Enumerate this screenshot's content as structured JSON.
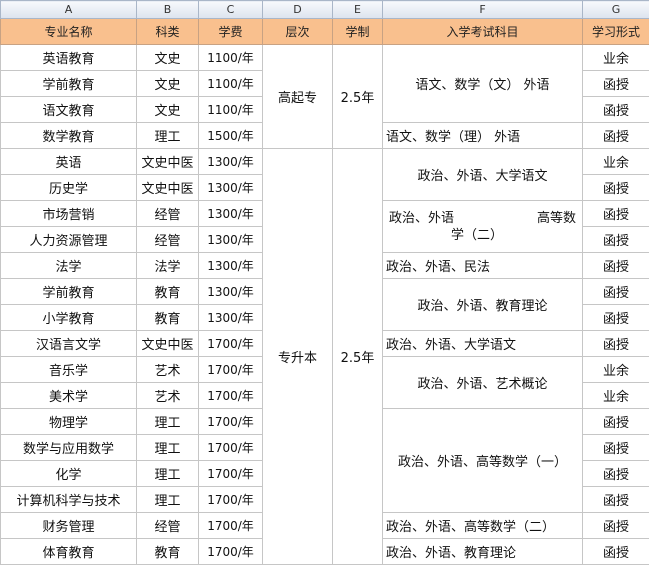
{
  "columns": [
    "A",
    "B",
    "C",
    "D",
    "E",
    "F",
    "G"
  ],
  "headers": [
    "专业名称",
    "科类",
    "学费",
    "层次",
    "学制",
    "入学考试科目",
    "学习形式"
  ],
  "groups": [
    {
      "level": "高起专",
      "duration": "2.5年"
    },
    {
      "level": "专升本",
      "duration": "2.5年"
    }
  ],
  "rows": [
    {
      "major": "英语教育",
      "category": "文史",
      "fee": "1100/年",
      "mode": "业余"
    },
    {
      "major": "学前教育",
      "category": "文史",
      "fee": "1100/年",
      "mode": "函授"
    },
    {
      "major": "语文教育",
      "category": "文史",
      "fee": "1100/年",
      "mode": "函授"
    },
    {
      "major": "数学教育",
      "category": "理工",
      "fee": "1500/年",
      "mode": "函授"
    },
    {
      "major": "英语",
      "category": "文史中医",
      "fee": "1300/年",
      "mode": "业余"
    },
    {
      "major": "历史学",
      "category": "文史中医",
      "fee": "1300/年",
      "mode": "函授"
    },
    {
      "major": "市场营销",
      "category": "经管",
      "fee": "1300/年",
      "mode": "函授"
    },
    {
      "major": "人力资源管理",
      "category": "经管",
      "fee": "1300/年",
      "mode": "函授"
    },
    {
      "major": "法学",
      "category": "法学",
      "fee": "1300/年",
      "mode": "函授"
    },
    {
      "major": "学前教育",
      "category": "教育",
      "fee": "1300/年",
      "mode": "函授"
    },
    {
      "major": "小学教育",
      "category": "教育",
      "fee": "1300/年",
      "mode": "函授"
    },
    {
      "major": "汉语言文学",
      "category": "文史中医",
      "fee": "1700/年",
      "mode": "函授"
    },
    {
      "major": "音乐学",
      "category": "艺术",
      "fee": "1700/年",
      "mode": "业余"
    },
    {
      "major": "美术学",
      "category": "艺术",
      "fee": "1700/年",
      "mode": "业余"
    },
    {
      "major": "物理学",
      "category": "理工",
      "fee": "1700/年",
      "mode": "函授"
    },
    {
      "major": "数学与应用数学",
      "category": "理工",
      "fee": "1700/年",
      "mode": "函授"
    },
    {
      "major": "化学",
      "category": "理工",
      "fee": "1700/年",
      "mode": "函授"
    },
    {
      "major": "计算机科学与技术",
      "category": "理工",
      "fee": "1700/年",
      "mode": "函授"
    },
    {
      "major": "财务管理",
      "category": "经管",
      "fee": "1700/年",
      "mode": "函授"
    },
    {
      "major": "体育教育",
      "category": "教育",
      "fee": "1700/年",
      "mode": "函授"
    }
  ],
  "exams": [
    "语文、数学（文） 外语",
    "语文、数学（理） 外语",
    "政治、外语、大学语文",
    {
      "a": "政治、外语",
      "b": "高等数",
      "c": "学（二）"
    },
    "政治、外语、民法",
    "政治、外语、教育理论",
    "政治、外语、大学语文",
    "政治、外语、艺术概论",
    "政治、外语、高等数学（一）",
    "政治、外语、高等数学（二）",
    "政治、外语、教育理论"
  ]
}
